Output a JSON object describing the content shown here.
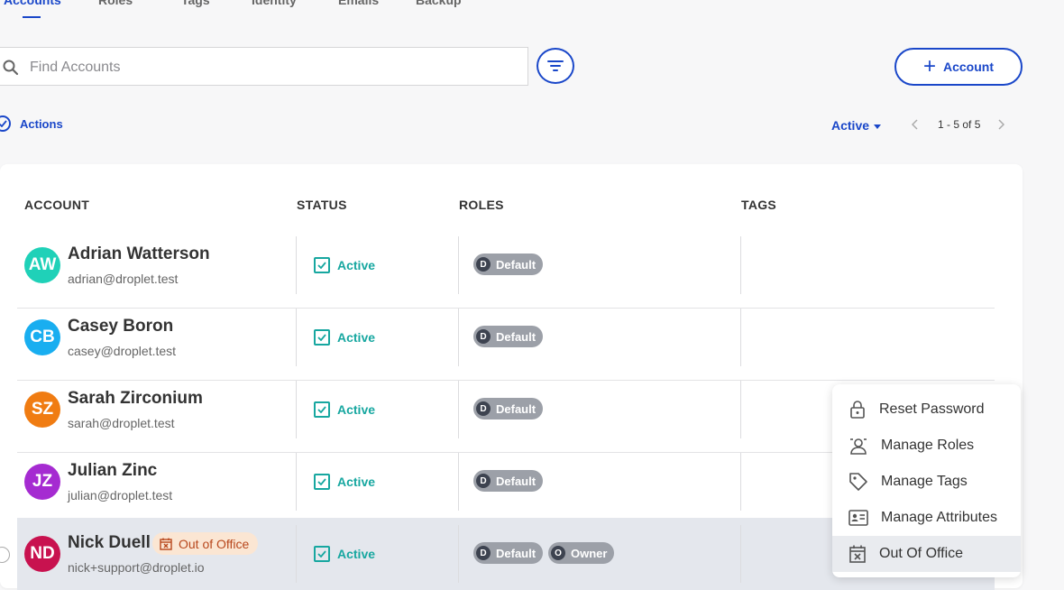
{
  "tabs": [
    "Accounts",
    "Roles",
    "Tags",
    "Identity",
    "Emails",
    "Backup"
  ],
  "search": {
    "placeholder": "Find Accounts"
  },
  "add_account_label": "Account",
  "actions_label": "Actions",
  "status_filter": "Active",
  "pagination": "1 - 5 of 5",
  "columns": [
    "ACCOUNT",
    "STATUS",
    "ROLES",
    "TAGS"
  ],
  "accounts": [
    {
      "initials": "AW",
      "name": "Adrian Watterson",
      "email": "adrian@droplet.test",
      "status": "Active",
      "roles": [
        {
          "letter": "D",
          "label": "Default"
        }
      ],
      "avatar_color": "#1fd1b8"
    },
    {
      "initials": "CB",
      "name": "Casey Boron",
      "email": "casey@droplet.test",
      "status": "Active",
      "roles": [
        {
          "letter": "D",
          "label": "Default"
        }
      ],
      "avatar_color": "#19aef0"
    },
    {
      "initials": "SZ",
      "name": "Sarah Zirconium",
      "email": "sarah@droplet.test",
      "status": "Active",
      "roles": [
        {
          "letter": "D",
          "label": "Default"
        }
      ],
      "avatar_color": "#f07c12"
    },
    {
      "initials": "JZ",
      "name": "Julian Zinc",
      "email": "julian@droplet.test",
      "status": "Active",
      "roles": [
        {
          "letter": "D",
          "label": "Default"
        }
      ],
      "avatar_color": "#a52bd1"
    },
    {
      "initials": "ND",
      "name": "Nick Duell",
      "email": "nick+support@droplet.io",
      "status": "Active",
      "badge": "Out of Office",
      "roles": [
        {
          "letter": "D",
          "label": "Default"
        },
        {
          "letter": "O",
          "label": "Owner"
        }
      ],
      "avatar_color": "#c8124f"
    }
  ],
  "context_menu": [
    {
      "label": "Reset Password",
      "icon": "lock-icon"
    },
    {
      "label": "Manage Roles",
      "icon": "user-role-icon"
    },
    {
      "label": "Manage Tags",
      "icon": "tag-icon"
    },
    {
      "label": "Manage Attributes",
      "icon": "id-card-icon"
    },
    {
      "label": "Out Of Office",
      "icon": "calendar-x-icon"
    }
  ],
  "colors": {
    "accent": "#1a47c9",
    "status_active": "#17a7a0",
    "ooo_text": "#b8471c",
    "ooo_bg": "#fbe6d3"
  }
}
